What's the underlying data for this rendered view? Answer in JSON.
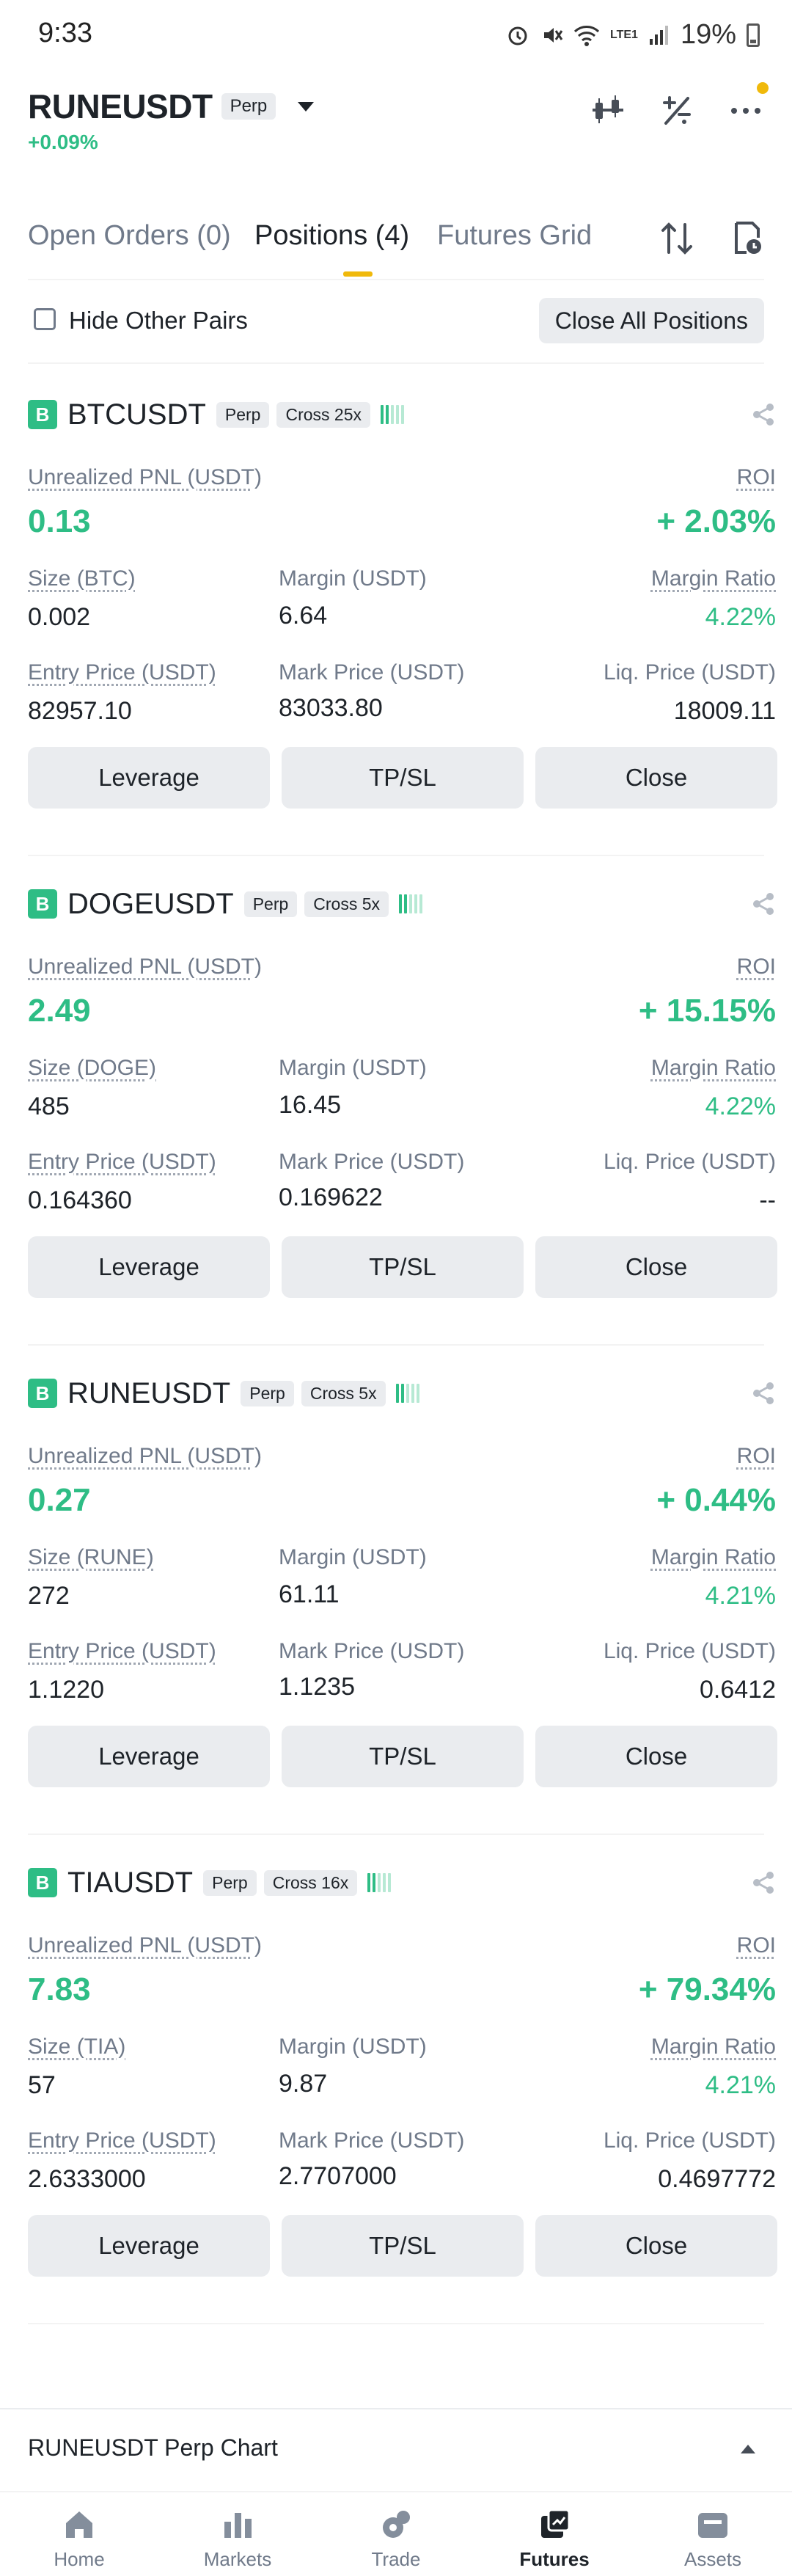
{
  "status_bar": {
    "time": "9:33",
    "battery": "19%",
    "network": "LTE1"
  },
  "header": {
    "pair": "RUNEUSDT",
    "tag": "Perp",
    "change": "+0.09%"
  },
  "tabs": [
    {
      "label": "Open Orders (0)"
    },
    {
      "label": "Positions (4)"
    },
    {
      "label": "Futures Grid"
    }
  ],
  "filter": {
    "hide_other_pairs": "Hide Other Pairs",
    "close_all": "Close All Positions"
  },
  "labels": {
    "unrealized_pnl": "Unrealized PNL (USDT)",
    "roi": "ROI",
    "margin": "Margin (USDT)",
    "margin_ratio": "Margin Ratio",
    "entry_price": "Entry Price (USDT)",
    "mark_price": "Mark Price (USDT)",
    "liq_price": "Liq. Price (USDT)",
    "leverage_btn": "Leverage",
    "tpsl_btn": "TP/SL",
    "close_btn": "Close",
    "badge": "B",
    "perp": "Perp"
  },
  "positions": [
    {
      "symbol": "BTCUSDT",
      "cross": "Cross 25x",
      "pnl": "0.13",
      "roi": "+ 2.03%",
      "size_label": "Size (BTC)",
      "size": "0.002",
      "margin": "6.64",
      "margin_ratio": "4.22%",
      "entry": "82957.10",
      "mark": "83033.80",
      "liq": "18009.11"
    },
    {
      "symbol": "DOGEUSDT",
      "cross": "Cross 5x",
      "pnl": "2.49",
      "roi": "+ 15.15%",
      "size_label": "Size (DOGE)",
      "size": "485",
      "margin": "16.45",
      "margin_ratio": "4.22%",
      "entry": "0.164360",
      "mark": "0.169622",
      "liq": "--"
    },
    {
      "symbol": "RUNEUSDT",
      "cross": "Cross 5x",
      "pnl": "0.27",
      "roi": "+ 0.44%",
      "size_label": "Size (RUNE)",
      "size": "272",
      "margin": "61.11",
      "margin_ratio": "4.21%",
      "entry": "1.1220",
      "mark": "1.1235",
      "liq": "0.6412"
    },
    {
      "symbol": "TIAUSDT",
      "cross": "Cross 16x",
      "pnl": "7.83",
      "roi": "+ 79.34%",
      "size_label": "Size (TIA)",
      "size": "57",
      "margin": "9.87",
      "margin_ratio": "4.21%",
      "entry": "2.6333000",
      "mark": "2.7707000",
      "liq": "0.4697772"
    }
  ],
  "chart_bar": {
    "title": "RUNEUSDT Perp Chart"
  },
  "bottom_nav": [
    {
      "label": "Home",
      "icon": "home-icon"
    },
    {
      "label": "Markets",
      "icon": "markets-icon"
    },
    {
      "label": "Trade",
      "icon": "trade-icon"
    },
    {
      "label": "Futures",
      "icon": "futures-icon"
    },
    {
      "label": "Assets",
      "icon": "wallet-icon"
    }
  ],
  "colors": {
    "accent": "#f0b90b",
    "positive": "#2ebd85",
    "text": "#1e2329",
    "muted": "#707a8a",
    "button_bg": "#eaecef"
  }
}
